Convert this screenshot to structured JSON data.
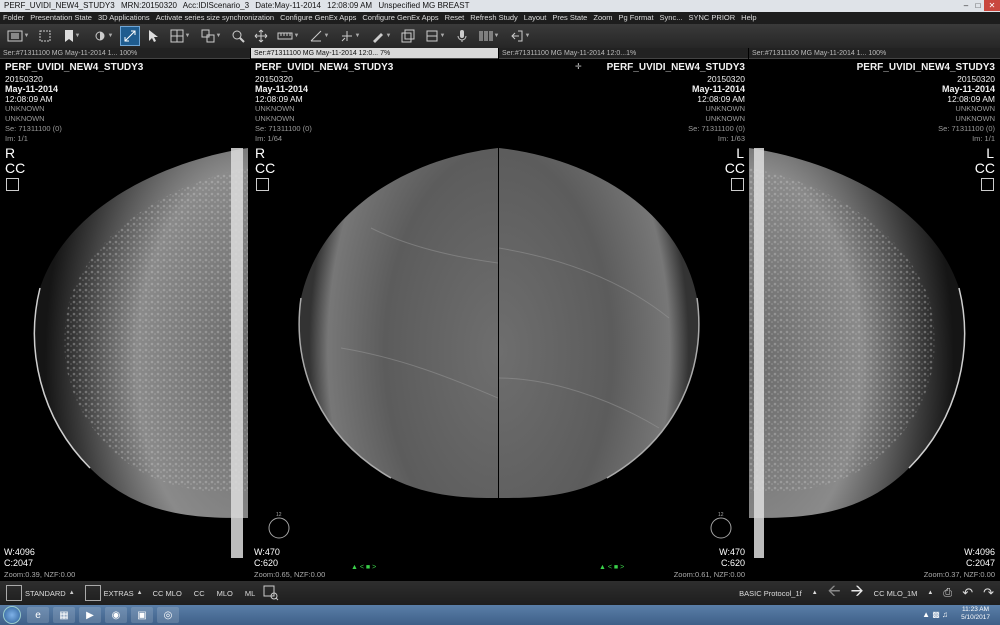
{
  "window": {
    "title_parts": [
      "PERF_UVIDI_NEW4_STUDY3",
      "MRN:20150320",
      "Acc:IDIScenario_3",
      "Date:May-11-2014",
      "12:08:09 AM",
      "Unspecified MG BREAST"
    ]
  },
  "menu": [
    "Folder",
    "Presentation State",
    "3D Applications",
    "Activate series size synchronization",
    "Configure GenEx Apps",
    "Configure GenEx Apps",
    "Reset",
    "Refresh Study",
    "Layout",
    "Pres State",
    "Zoom",
    "Pg Format",
    "Sync...",
    "SYNC PRIOR",
    "Help"
  ],
  "toolbar": [
    {
      "icon": "film-icon"
    },
    {
      "icon": "select-area-icon"
    },
    {
      "icon": "bookmark-icon"
    },
    {
      "icon": "brightness-icon"
    },
    {
      "icon": "magnify-toggle-icon",
      "active": true
    },
    {
      "icon": "pointer-icon"
    },
    {
      "icon": "grid-icon"
    },
    {
      "icon": "layout-icon"
    },
    {
      "icon": "zoom-icon"
    },
    {
      "icon": "pan-icon"
    },
    {
      "icon": "ruler-icon"
    },
    {
      "icon": "angle-icon"
    },
    {
      "icon": "axis-icon"
    },
    {
      "icon": "annotation-icon"
    },
    {
      "icon": "stack-icon"
    },
    {
      "icon": "layers-icon"
    },
    {
      "icon": "microphone-icon"
    },
    {
      "icon": "barcode-icon"
    },
    {
      "icon": "exit-icon"
    }
  ],
  "viewports": [
    {
      "header": "Ser:#71311100  MG May-11-2014 1...  100%",
      "selected": false,
      "patient": "PERF_UVIDI_NEW4_STUDY3",
      "mrn": "20150320",
      "date": "May-11-2014",
      "time": "12:08:09 AM",
      "line1": "UNKNOWN",
      "line2": "UNKNOWN",
      "series": "Se: 71311100 (0)",
      "image": "Im: 1/1",
      "laterality": "R",
      "view": "CC",
      "window": "W:4096",
      "center": "C:2047",
      "zoom": "Zoom:0.39, NZF:0.00"
    },
    {
      "header": "Ser:#71311100  MG May-11-2014 12:0...  7%",
      "selected": true,
      "patient": "PERF_UVIDI_NEW4_STUDY3",
      "mrn": "20150320",
      "date": "May-11-2014",
      "time": "12:08:09 AM",
      "line1": "UNKNOWN",
      "line2": "UNKNOWN",
      "series": "Se: 71311100 (0)",
      "image": "Im: 1/64",
      "laterality": "R",
      "view": "CC",
      "window": "W:470",
      "center": "C:620",
      "zoom": "Zoom:0.65, NZF:0.00"
    },
    {
      "header": "Ser:#71311100  MG May-11-2014 12:0...1%",
      "selected": false,
      "patient": "PERF_UVIDI_NEW4_STUDY3",
      "mrn": "20150320",
      "date": "May-11-2014",
      "time": "12:08:09 AM",
      "line1": "UNKNOWN",
      "line2": "UNKNOWN",
      "series": "Se: 71311100 (0)",
      "image": "Im: 1/63",
      "laterality": "L",
      "view": "CC",
      "window": "W:470",
      "center": "C:620",
      "zoom": "Zoom:0.61, NZF:0.00"
    },
    {
      "header": "Ser:#71311100  MG May-11-2014 1...  100%",
      "selected": false,
      "patient": "PERF_UVIDI_NEW4_STUDY3",
      "mrn": "20150320",
      "date": "May-11-2014",
      "time": "12:08:09 AM",
      "line1": "UNKNOWN",
      "line2": "UNKNOWN",
      "series": "Se: 71311100 (0)",
      "image": "Im: 1/1",
      "laterality": "L",
      "view": "CC",
      "window": "W:4096",
      "center": "C:2047",
      "zoom": "Zoom:0.37, NZF:0.00"
    }
  ],
  "bottombar": {
    "standard": "STANDARD",
    "extras": "EXTRAS",
    "cc_mlo": "CC MLO",
    "cc": "CC",
    "mlo": "MLO",
    "ml": "ML",
    "protocol": "BASIC Protocol_1f",
    "hanging": "CC MLO_1M"
  },
  "taskbar": {
    "time": "11:23 AM",
    "date": "5/10/2017"
  }
}
